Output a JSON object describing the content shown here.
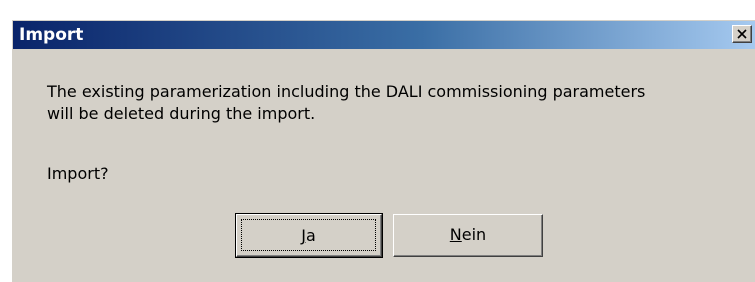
{
  "window": {
    "title": "Import"
  },
  "message": {
    "line1": "The existing paramerization including the DALI commissioning parameters",
    "line2": "will be deleted during the import.",
    "question": "Import?"
  },
  "buttons": {
    "yes": {
      "mnemonic": "J",
      "rest": "a"
    },
    "no": {
      "mnemonic": "N",
      "rest": "ein"
    }
  },
  "colors": {
    "titlebar_start": "#0a246a",
    "titlebar_end": "#a6caf0",
    "dialog_face": "#d4d0c8"
  },
  "icons": {
    "close": "close-icon"
  }
}
